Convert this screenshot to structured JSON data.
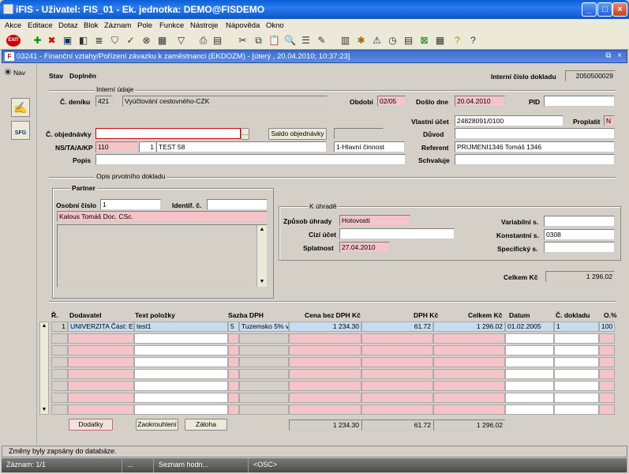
{
  "window": {
    "title": "iFIS - Uživatel: FIS_01 - Ek. jednotka: DEMO@FISDEMO"
  },
  "menu": [
    "Akce",
    "Editace",
    "Dotaz",
    "Blok",
    "Záznam",
    "Pole",
    "Funkce",
    "Nástroje",
    "Nápověda",
    "Okno"
  ],
  "toolbar_icons": [
    "exit-icon",
    "insert-record-icon",
    "delete-record-icon",
    "save-icon",
    "clear-icon",
    "filter-icon",
    "print-icon",
    "cut-icon",
    "copy-icon",
    "paste-icon",
    "list-icon",
    "edit-icon",
    "calendar-icon",
    "settings-icon",
    "warning-icon",
    "clock-icon",
    "excel-icon",
    "export-icon",
    "help-icon",
    "context-help-icon"
  ],
  "document": {
    "title": "03241 - Finanční vztahy/Pořízení závazku k zaměstnanci (EKDOZM) - [úterý , 20.04.2010; 10:37:23]"
  },
  "left_panel": {
    "nav_label": "Nav"
  },
  "header": {
    "stav_label": "Stav",
    "stav_value": "Doplněn",
    "interni_cislo_label": "Interní číslo dokladu",
    "interni_cislo_value": "2050500029",
    "interni_udaje_section": "Interní údaje",
    "cislo_deniku_label": "Č. deníku",
    "cislo_deniku_code": "421",
    "cislo_deniku_name": "Vyúčtování cestovného-CZK",
    "obdobi_label": "Období",
    "obdobi_value": "02/05",
    "doslo_dne_label": "Došlo dne",
    "doslo_dne_value": "20.04.2010",
    "pid_label": "PID",
    "pid_value": "",
    "vlastni_ucet_label": "Vlastní účet",
    "vlastni_ucet_value": "24828091/0100",
    "proplatit_label": "Proplatit",
    "proplatit_value": "N",
    "objednavky_label": "Č. objednávky",
    "objednavky_value": "",
    "saldo_button": "Saldo objednávky",
    "duvod_label": "Důvod",
    "duvod_value": "",
    "ns_label": "NS/TA/A/KP",
    "ns_1": "110",
    "ns_2": "1",
    "ns_3": "TEST 58",
    "ns_4": "1-Hlavní činnost",
    "referent_label": "Referent",
    "referent_value": "PRIJMENI1346 Tomáš 1346",
    "popis_label": "Popis",
    "popis_value": "",
    "schvaluje_label": "Schvaluje",
    "schvaluje_value": ""
  },
  "opis": {
    "section": "Opis prvotního dokladu"
  },
  "partner": {
    "section": "Partner",
    "osobni_cislo_label": "Osobní číslo",
    "osobni_cislo_value": "1",
    "identif_label": "Identif. č.",
    "identif_value": "",
    "name": "Kalous Tomáš Doc. CSc."
  },
  "uhrada": {
    "section": "K úhradě",
    "zpusob_label": "Způsob úhrady",
    "zpusob_value": "Hotovostí",
    "cizi_ucet_label": "Cizí účet",
    "cizi_ucet_value": "",
    "splatnost_label": "Splatnost",
    "splatnost_value": "27.04.2010",
    "variabilni_label": "Variabilní s.",
    "variabilni_value": "",
    "konstantni_label": "Konstantní s.",
    "konstantni_value": "0308",
    "specificky_label": "Specifický s.",
    "specificky_value": ""
  },
  "celkem": {
    "label": "Celkem Kč",
    "value": "1 296.02"
  },
  "table": {
    "headers": {
      "r": "Ř.",
      "dodavatel": "Dodavatel",
      "text": "Text položky",
      "sazba": "Sazba DPH",
      "cena": "Cena bez DPH Kč",
      "dph": "DPH Kč",
      "celkem": "Celkem Kč",
      "datum": "Datum",
      "doklad": "Č. dokladu",
      "o": "O.%"
    },
    "rows": [
      {
        "r": "1",
        "dodavatel": "UNIVERZITA Část: Ekon",
        "text": "test1",
        "sazba_code": "5",
        "sazba": "Tuzemsko 5% v",
        "cena": "1 234.30",
        "dph": "61.72",
        "celkem": "1 296.02",
        "datum": "01.02.2005",
        "doklad": "1",
        "o": "100"
      }
    ],
    "empty_rows": 7,
    "totals": {
      "cena": "1 234.30",
      "dph": "61.72",
      "celkem": "1 296.02"
    }
  },
  "buttons": {
    "dodatky": "Dodatky",
    "zaokrouhleni": "Zaokrouhlení",
    "zaloha": "Záloha"
  },
  "status": {
    "message": "Změny byly zapsány do databáze.",
    "zaznam": "Záznam: 1/1",
    "dots": "...",
    "seznam": "Seznam hodn...",
    "osc": "<OSC>"
  }
}
